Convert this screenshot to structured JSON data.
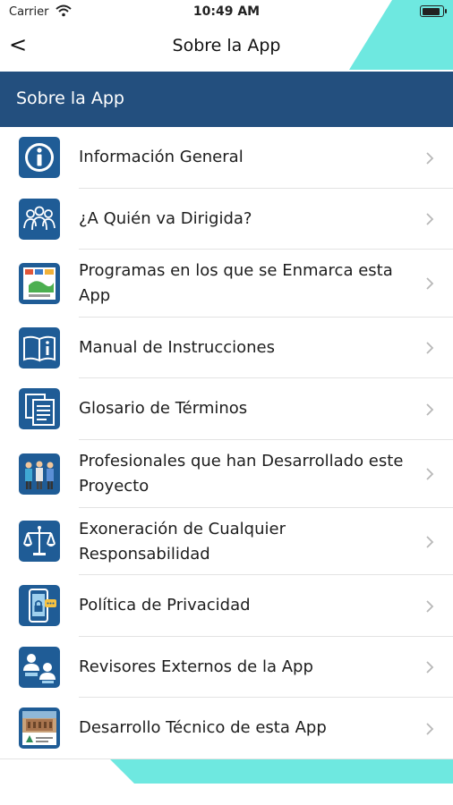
{
  "status_bar": {
    "carrier": "Carrier",
    "time": "10:49 AM"
  },
  "nav": {
    "back_label": "<",
    "title": "Sobre la App"
  },
  "section": {
    "title": "Sobre la App"
  },
  "colors": {
    "header_bg": "#234f7e",
    "accent_teal": "#6ee8e0",
    "icon_blue": "#1f5c96"
  },
  "items": [
    {
      "label": "Información General",
      "icon": "info-icon"
    },
    {
      "label": "¿A Quién va Dirigida?",
      "icon": "people-group-icon"
    },
    {
      "label": "Programas en los que se Enmarca esta App",
      "icon": "programs-document-icon"
    },
    {
      "label": "Manual de Instrucciones",
      "icon": "book-info-icon"
    },
    {
      "label": "Glosario de Términos",
      "icon": "documents-icon"
    },
    {
      "label": "Profesionales que han Desarrollado este Proyecto",
      "icon": "professionals-icon"
    },
    {
      "label": "Exoneración de Cualquier Responsabilidad",
      "icon": "scales-icon"
    },
    {
      "label": "Política de Privacidad",
      "icon": "phone-lock-icon"
    },
    {
      "label": "Revisores Externos de la App",
      "icon": "reviewers-icon"
    },
    {
      "label": "Desarrollo Técnico de esta App",
      "icon": "building-photo-icon"
    }
  ]
}
